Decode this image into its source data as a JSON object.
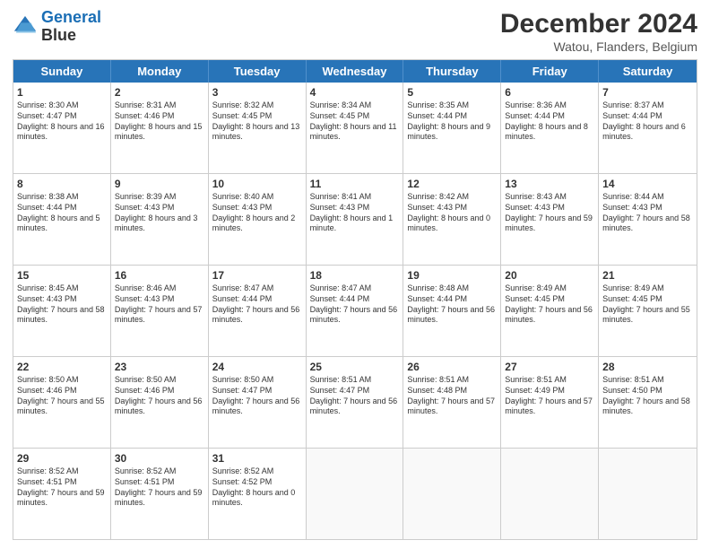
{
  "header": {
    "logo_line1": "General",
    "logo_line2": "Blue",
    "title": "December 2024",
    "subtitle": "Watou, Flanders, Belgium"
  },
  "days_of_week": [
    "Sunday",
    "Monday",
    "Tuesday",
    "Wednesday",
    "Thursday",
    "Friday",
    "Saturday"
  ],
  "weeks": [
    [
      {
        "day": "1",
        "info": "Sunrise: 8:30 AM\nSunset: 4:47 PM\nDaylight: 8 hours and 16 minutes."
      },
      {
        "day": "2",
        "info": "Sunrise: 8:31 AM\nSunset: 4:46 PM\nDaylight: 8 hours and 15 minutes."
      },
      {
        "day": "3",
        "info": "Sunrise: 8:32 AM\nSunset: 4:45 PM\nDaylight: 8 hours and 13 minutes."
      },
      {
        "day": "4",
        "info": "Sunrise: 8:34 AM\nSunset: 4:45 PM\nDaylight: 8 hours and 11 minutes."
      },
      {
        "day": "5",
        "info": "Sunrise: 8:35 AM\nSunset: 4:44 PM\nDaylight: 8 hours and 9 minutes."
      },
      {
        "day": "6",
        "info": "Sunrise: 8:36 AM\nSunset: 4:44 PM\nDaylight: 8 hours and 8 minutes."
      },
      {
        "day": "7",
        "info": "Sunrise: 8:37 AM\nSunset: 4:44 PM\nDaylight: 8 hours and 6 minutes."
      }
    ],
    [
      {
        "day": "8",
        "info": "Sunrise: 8:38 AM\nSunset: 4:44 PM\nDaylight: 8 hours and 5 minutes."
      },
      {
        "day": "9",
        "info": "Sunrise: 8:39 AM\nSunset: 4:43 PM\nDaylight: 8 hours and 3 minutes."
      },
      {
        "day": "10",
        "info": "Sunrise: 8:40 AM\nSunset: 4:43 PM\nDaylight: 8 hours and 2 minutes."
      },
      {
        "day": "11",
        "info": "Sunrise: 8:41 AM\nSunset: 4:43 PM\nDaylight: 8 hours and 1 minute."
      },
      {
        "day": "12",
        "info": "Sunrise: 8:42 AM\nSunset: 4:43 PM\nDaylight: 8 hours and 0 minutes."
      },
      {
        "day": "13",
        "info": "Sunrise: 8:43 AM\nSunset: 4:43 PM\nDaylight: 7 hours and 59 minutes."
      },
      {
        "day": "14",
        "info": "Sunrise: 8:44 AM\nSunset: 4:43 PM\nDaylight: 7 hours and 58 minutes."
      }
    ],
    [
      {
        "day": "15",
        "info": "Sunrise: 8:45 AM\nSunset: 4:43 PM\nDaylight: 7 hours and 58 minutes."
      },
      {
        "day": "16",
        "info": "Sunrise: 8:46 AM\nSunset: 4:43 PM\nDaylight: 7 hours and 57 minutes."
      },
      {
        "day": "17",
        "info": "Sunrise: 8:47 AM\nSunset: 4:44 PM\nDaylight: 7 hours and 56 minutes."
      },
      {
        "day": "18",
        "info": "Sunrise: 8:47 AM\nSunset: 4:44 PM\nDaylight: 7 hours and 56 minutes."
      },
      {
        "day": "19",
        "info": "Sunrise: 8:48 AM\nSunset: 4:44 PM\nDaylight: 7 hours and 56 minutes."
      },
      {
        "day": "20",
        "info": "Sunrise: 8:49 AM\nSunset: 4:45 PM\nDaylight: 7 hours and 56 minutes."
      },
      {
        "day": "21",
        "info": "Sunrise: 8:49 AM\nSunset: 4:45 PM\nDaylight: 7 hours and 55 minutes."
      }
    ],
    [
      {
        "day": "22",
        "info": "Sunrise: 8:50 AM\nSunset: 4:46 PM\nDaylight: 7 hours and 55 minutes."
      },
      {
        "day": "23",
        "info": "Sunrise: 8:50 AM\nSunset: 4:46 PM\nDaylight: 7 hours and 56 minutes."
      },
      {
        "day": "24",
        "info": "Sunrise: 8:50 AM\nSunset: 4:47 PM\nDaylight: 7 hours and 56 minutes."
      },
      {
        "day": "25",
        "info": "Sunrise: 8:51 AM\nSunset: 4:47 PM\nDaylight: 7 hours and 56 minutes."
      },
      {
        "day": "26",
        "info": "Sunrise: 8:51 AM\nSunset: 4:48 PM\nDaylight: 7 hours and 57 minutes."
      },
      {
        "day": "27",
        "info": "Sunrise: 8:51 AM\nSunset: 4:49 PM\nDaylight: 7 hours and 57 minutes."
      },
      {
        "day": "28",
        "info": "Sunrise: 8:51 AM\nSunset: 4:50 PM\nDaylight: 7 hours and 58 minutes."
      }
    ],
    [
      {
        "day": "29",
        "info": "Sunrise: 8:52 AM\nSunset: 4:51 PM\nDaylight: 7 hours and 59 minutes."
      },
      {
        "day": "30",
        "info": "Sunrise: 8:52 AM\nSunset: 4:51 PM\nDaylight: 7 hours and 59 minutes."
      },
      {
        "day": "31",
        "info": "Sunrise: 8:52 AM\nSunset: 4:52 PM\nDaylight: 8 hours and 0 minutes."
      },
      {
        "day": "",
        "info": ""
      },
      {
        "day": "",
        "info": ""
      },
      {
        "day": "",
        "info": ""
      },
      {
        "day": "",
        "info": ""
      }
    ]
  ]
}
